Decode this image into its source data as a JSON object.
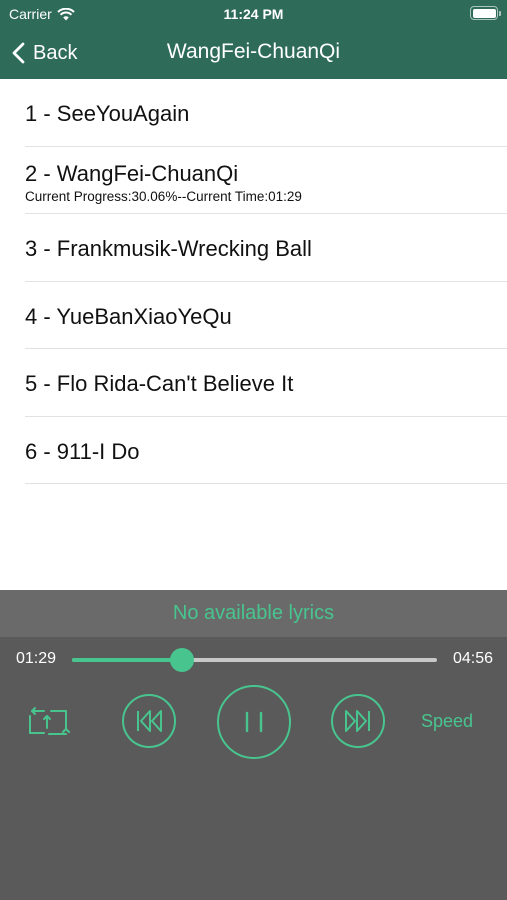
{
  "status_bar": {
    "carrier": "Carrier",
    "time": "11:24 PM",
    "icons": [
      "wifi-icon",
      "battery-icon"
    ]
  },
  "nav": {
    "back_label": "Back",
    "title": "WangFei-ChuanQi"
  },
  "songs": [
    {
      "label": "1 - SeeYouAgain"
    },
    {
      "label": "2 - WangFei-ChuanQi",
      "progress_text": "Current Progress:30.06%--Current Time:01:29"
    },
    {
      "label": "3 - Frankmusik-Wrecking Ball"
    },
    {
      "label": "4 - YueBanXiaoYeQu"
    },
    {
      "label": "5 - Flo Rida-Can't Believe It"
    },
    {
      "label": "6 - 911-I Do"
    }
  ],
  "player": {
    "lyrics": "No available lyrics",
    "current_time": "01:29",
    "total_time": "04:56",
    "progress": 0.3006,
    "speed_label": "Speed",
    "controls": [
      "repeat-icon",
      "previous-icon",
      "pause-icon",
      "next-icon"
    ]
  },
  "colors": {
    "header": "#2e6b58",
    "accent": "#48c58f",
    "player_bg": "#5a5a5a",
    "lyrics_bg": "#6a6a6a"
  }
}
